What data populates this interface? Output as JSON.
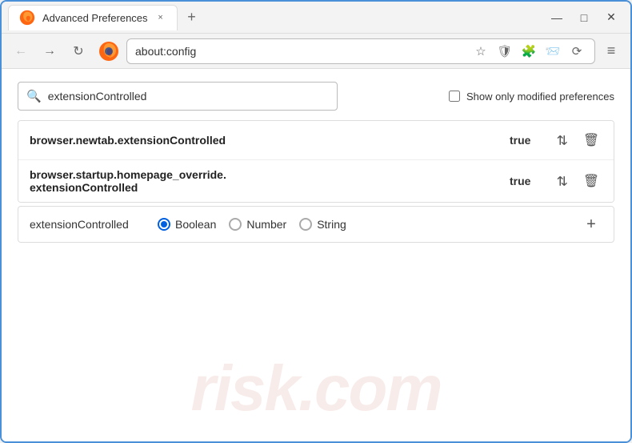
{
  "window": {
    "title": "Advanced Preferences",
    "tab_label": "Advanced Preferences",
    "tab_close": "×",
    "new_tab": "+",
    "win_minimize": "—",
    "win_maximize": "□",
    "win_close": "✕"
  },
  "navbar": {
    "back_label": "←",
    "forward_label": "→",
    "reload_label": "↻",
    "firefox_label": "Firefox",
    "address": "about:config",
    "bookmark_icon": "☆",
    "shield_icon": "🛡",
    "ext_icon": "🧩",
    "share_icon": "📨",
    "sync_icon": "⟳",
    "menu_icon": "≡"
  },
  "search": {
    "placeholder": "extensionControlled",
    "value": "extensionControlled",
    "checkbox_label": "Show only modified preferences"
  },
  "results": [
    {
      "name": "browser.newtab.extensionControlled",
      "value": "true"
    },
    {
      "name_line1": "browser.startup.homepage_override.",
      "name_line2": "extensionControlled",
      "value": "true"
    }
  ],
  "add_row": {
    "name": "extensionControlled",
    "type_options": [
      {
        "label": "Boolean",
        "selected": true
      },
      {
        "label": "Number",
        "selected": false
      },
      {
        "label": "String",
        "selected": false
      }
    ],
    "add_btn": "+"
  },
  "watermark": "risk.com"
}
